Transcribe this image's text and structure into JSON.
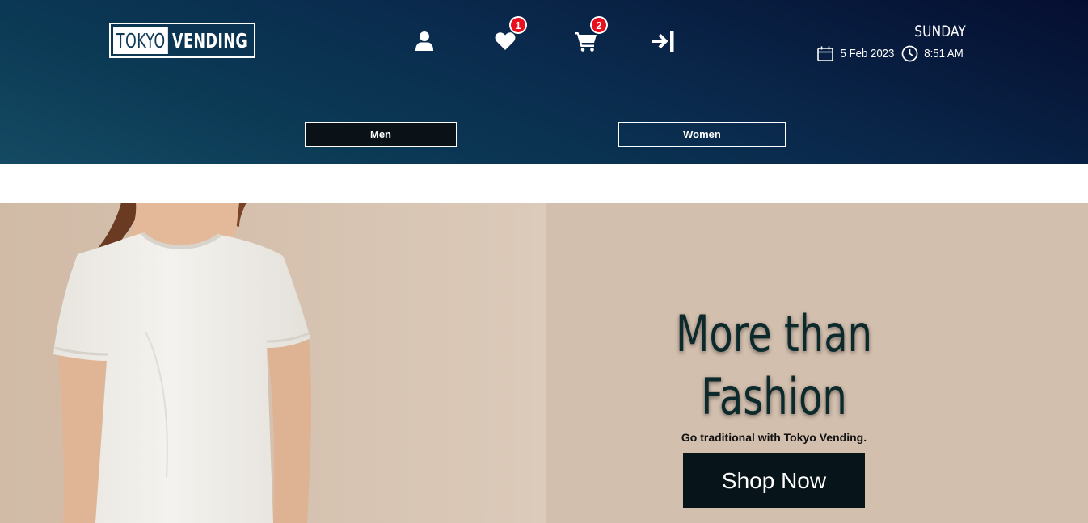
{
  "brand": {
    "logo_part1": "TOKYO",
    "logo_part2": "VENDING"
  },
  "nav": {
    "icons": [
      "user-icon",
      "heart-icon",
      "cart-icon",
      "login-icon"
    ],
    "wishlist_count": "1",
    "cart_count": "2"
  },
  "datetime": {
    "day": "SUNDAY",
    "date": "5 Feb 2023",
    "time": "8:51 AM"
  },
  "categories": [
    {
      "label": "Men"
    },
    {
      "label": "Women"
    }
  ],
  "hero": {
    "headline_line1": "More than",
    "headline_line2": "Fashion",
    "tagline": "Go traditional with Tokyo Vending.",
    "cta_label": "Shop Now"
  },
  "colors": {
    "header_dark": "#050e30",
    "header_teal": "#154a63",
    "badge_red": "#e8101e",
    "hero_bg": "#d3bfae",
    "cta_bg": "#071419",
    "headline": "#0c2a2c"
  }
}
